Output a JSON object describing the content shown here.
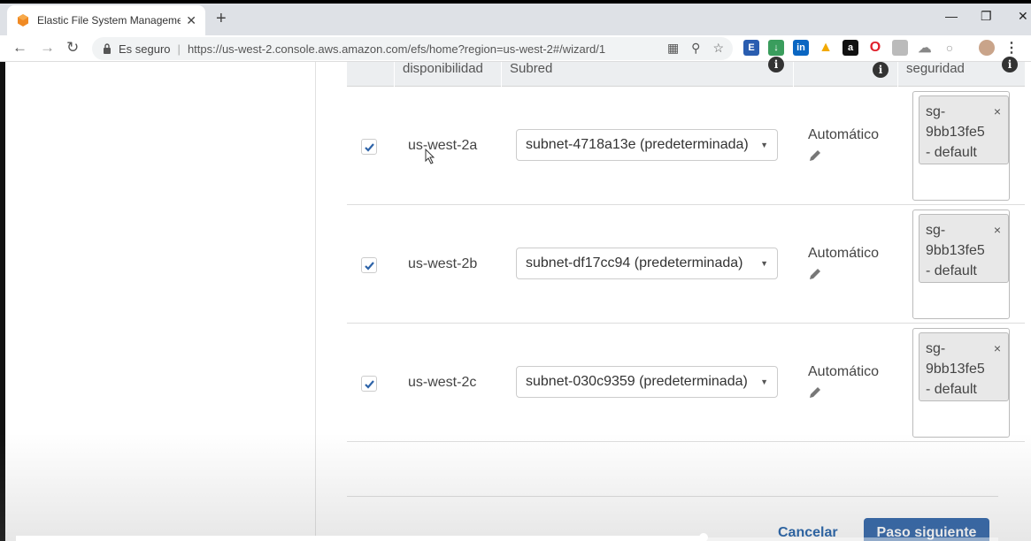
{
  "browser": {
    "tab_title": "Elastic File System Management",
    "secure_label": "Es seguro",
    "url_separator": "|",
    "url": "https://us-west-2.console.aws.amazon.com/efs/home?region=us-west-2#/wizard/1",
    "new_tab": "+",
    "tab_close": "✕",
    "window_controls": {
      "minimize": "—",
      "maximize": "❐",
      "close": "✕"
    },
    "extensions": [
      {
        "icon": "translate-icon"
      },
      {
        "icon": "zoom-icon"
      },
      {
        "icon": "star-icon"
      }
    ]
  },
  "table": {
    "headers": {
      "availability_zone": "disponibilidad",
      "subnet": "Subred",
      "security": "seguridad"
    },
    "rows": [
      {
        "checked": true,
        "zone": "us-west-2a",
        "subnet": "subnet-4718a13e (predeterminada)",
        "ip": "Automático",
        "sg_line1": "sg-",
        "sg_line2": "9bb13fe5",
        "sg_line3": "- default"
      },
      {
        "checked": true,
        "zone": "us-west-2b",
        "subnet": "subnet-df17cc94 (predeterminada)",
        "ip": "Automático",
        "sg_line1": "sg-",
        "sg_line2": "9bb13fe5",
        "sg_line3": "- default"
      },
      {
        "checked": true,
        "zone": "us-west-2c",
        "subnet": "subnet-030c9359 (predeterminada)",
        "ip": "Automático",
        "sg_line1": "sg-",
        "sg_line2": "9bb13fe5",
        "sg_line3": "- default"
      }
    ],
    "sg_remove": "×",
    "select_caret": "▼"
  },
  "footer": {
    "cancel_label": "Cancelar",
    "next_label": "Paso siguiente"
  },
  "colors": {
    "primary_button": "#2d63a8",
    "link": "#1f5fa8",
    "check": "#2d63a8"
  }
}
